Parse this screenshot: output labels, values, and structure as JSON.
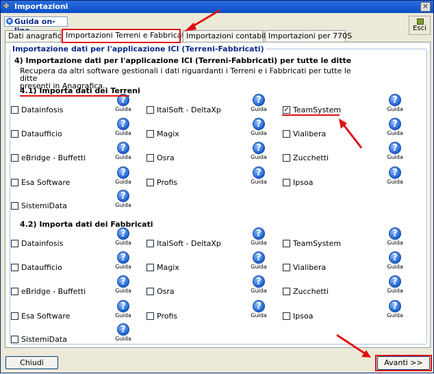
{
  "window": {
    "title": "Importazioni",
    "close_glyph": "✕"
  },
  "toolbar": {
    "help_label": "Guida on-line",
    "exit_label": "Esci"
  },
  "tabs": [
    {
      "label": "Dati anagrafici",
      "active": false
    },
    {
      "label": "Importazioni Terreni e Fabbricati",
      "active": true
    },
    {
      "label": "Importazioni contabili",
      "active": false
    },
    {
      "label": "Importazioni per 770S",
      "active": false
    }
  ],
  "group": {
    "legend": "Importazione dati per l'applicazione ICI (Terreni-Fabbricati)",
    "heading": "4) Importazione dati per l'applicazione ICI (Terreni-Fabbricati) per tutte le ditte",
    "description_line1": "Recupera da altri software gestionali i dati riguardanti i Terreni e i Fabbricati per tutte le ditte",
    "description_line2": "presenti in Anagrafica."
  },
  "help_caption": "Guida",
  "sections": [
    {
      "title": "4.1) Importa dati dei Terreni",
      "options": [
        {
          "label": "Datainfosis",
          "checked": false
        },
        {
          "label": "ItalSoft - DeltaXp",
          "checked": false
        },
        {
          "label": "TeamSystem",
          "checked": true
        },
        {
          "label": "Dataufficio",
          "checked": false
        },
        {
          "label": "Magix",
          "checked": false
        },
        {
          "label": "Vialibera",
          "checked": false
        },
        {
          "label": "eBridge - Buffetti",
          "checked": false
        },
        {
          "label": "Osra",
          "checked": false
        },
        {
          "label": "Zucchetti",
          "checked": false
        },
        {
          "label": "Esa Software",
          "checked": false
        },
        {
          "label": "Profis",
          "checked": false
        },
        {
          "label": "Ipsoa",
          "checked": false
        },
        {
          "label": "SistemiData",
          "checked": false
        }
      ]
    },
    {
      "title": "4.2) Importa dati dei Fabbricati",
      "options": [
        {
          "label": "Datainfosis",
          "checked": false
        },
        {
          "label": "ItalSoft - DeltaXp",
          "checked": false
        },
        {
          "label": "TeamSystem",
          "checked": false
        },
        {
          "label": "Dataufficio",
          "checked": false
        },
        {
          "label": "Magix",
          "checked": false
        },
        {
          "label": "Vialibera",
          "checked": false
        },
        {
          "label": "eBridge - Buffetti",
          "checked": false
        },
        {
          "label": "Osra",
          "checked": false
        },
        {
          "label": "Zucchetti",
          "checked": false
        },
        {
          "label": "Esa Software",
          "checked": false
        },
        {
          "label": "Profis",
          "checked": false
        },
        {
          "label": "Ipsoa",
          "checked": false
        },
        {
          "label": "SistemiData",
          "checked": false
        }
      ]
    }
  ],
  "footer": {
    "close_label": "Chiudi",
    "next_label": "Avanti >>"
  },
  "colors": {
    "annotation": "#e01010",
    "title_bar": "#0a4fc6"
  }
}
